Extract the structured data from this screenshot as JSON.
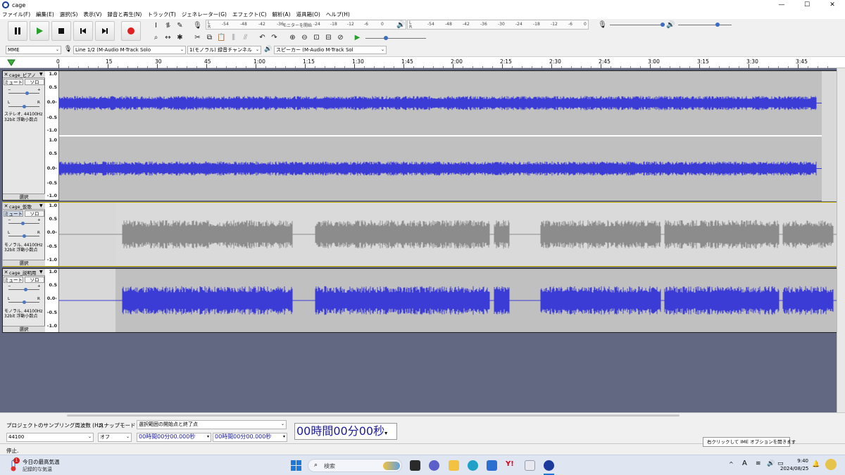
{
  "window": {
    "title": "cage",
    "minimize": "—",
    "maximize": "☐",
    "close": "✕"
  },
  "menu": [
    "ファイル(F)",
    "編集(E)",
    "選択(S)",
    "表示(V)",
    "録音と再生(N)",
    "トラック(T)",
    "ジェネレーター(G)",
    "エフェクト(C)",
    "解析(A)",
    "道具箱(O)",
    "ヘルプ(H)"
  ],
  "meters": {
    "rec_ticks": [
      "-54",
      "-48",
      "-42",
      "-36",
      "-30",
      "-24",
      "-18",
      "-12",
      "-6",
      "0"
    ],
    "rec_label": "モニターを開始",
    "play_ticks": [
      "-54",
      "-48",
      "-42",
      "-36",
      "-30",
      "-24",
      "-18",
      "-12",
      "-6",
      "0"
    ],
    "lr": [
      "L",
      "R"
    ]
  },
  "devices": {
    "host": "MME",
    "input": "Line 1/2 (M-Audio M-Track Solo",
    "channels": "1(モノラル) 録音チャンネル",
    "output": "スピーカー (M-Audio M-Track Sol"
  },
  "ruler": {
    "labels": [
      "0",
      "15",
      "30",
      "45",
      "1:00",
      "1:15",
      "1:30",
      "1:45",
      "2:00",
      "2:15",
      "2:30",
      "2:45",
      "3:00",
      "3:15",
      "3:30",
      "3:45"
    ]
  },
  "colors": {
    "wave_selected": "#3b3bd6",
    "wave_muted": "#8c8c8c",
    "track_bg": "#c0c0c0",
    "track_area": "#636882"
  },
  "tracks": [
    {
      "name": "cage_ピアノ",
      "mute": "ミュート",
      "solo": "ソロ",
      "info1": "ステレオ, 44100Hz",
      "info2": "32bit 浮動小数点",
      "select": "選択",
      "scale": [
        "1.0",
        "0.5",
        "0.0-",
        "-0.5",
        "-1.0"
      ],
      "scale2": [
        "1.0",
        "0.5",
        "0.0-",
        "-0.5",
        "-1.0"
      ],
      "state": "stereo"
    },
    {
      "name": "cage_仮歌",
      "mute": "ミュート",
      "solo": "ソロ",
      "info1": "モノラル, 44100Hz",
      "info2": "32bit 浮動小数点",
      "select": "選択",
      "scale": [
        "1.0",
        "0.5",
        "0.0-",
        "-0.5",
        "-1.0"
      ],
      "state": "muted"
    },
    {
      "name": "cage_説明用",
      "mute": "ミュート",
      "solo": "ソロ",
      "info1": "モノラル, 44100Hz",
      "info2": "32bit 浮動小数点",
      "select": "選択",
      "scale": [
        "1.0",
        "0.5",
        "0.0-",
        "-0.5",
        "-1.0"
      ],
      "state": "active"
    }
  ],
  "selection": {
    "rate_label": "プロジェクトのサンプリング周波数 (Hz)",
    "rate_value": "44100",
    "snap_label": "スナップモード",
    "snap_value": "オフ",
    "range_label": "選択範囲の開始点と終了点",
    "start": "00時間00分00.000秒",
    "end": "00時間00分00.000秒",
    "position": "00時間00分00秒"
  },
  "status": "停止.",
  "tooltip": "右クリックして IME オプションを開きます",
  "taskbar": {
    "weather_line1": "今日の最高気温",
    "weather_line2": "記録的な気温",
    "weather_badge": "1",
    "search": "検索",
    "ime": "A",
    "time": "9:40",
    "date": "2024/08/25"
  }
}
